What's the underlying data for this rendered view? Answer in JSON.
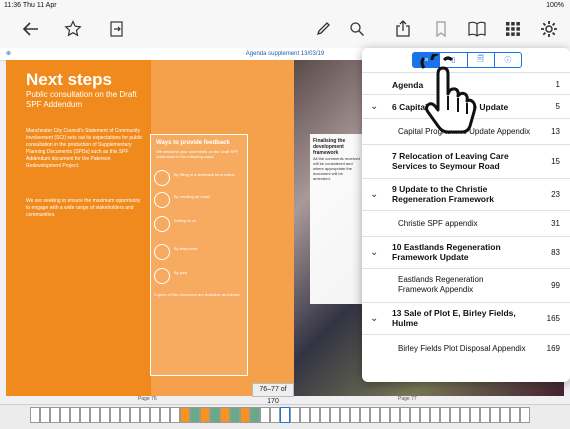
{
  "status": {
    "time": "11:36  Thu 11 Apr",
    "battery": "100%"
  },
  "toolbar": {
    "back": "arrow-left-icon",
    "star": "star-icon",
    "export": "export-icon",
    "pen": "pen-icon",
    "search": "search-icon",
    "share": "share-icon",
    "bookmark": "bookmark-icon",
    "book": "book-icon",
    "grid": "grid-icon",
    "settings": "gear-icon"
  },
  "doc": {
    "title": "Agenda supplement 13/03/19"
  },
  "page_content": {
    "heading": "Next steps",
    "subheading": "Public consultation on the Draft SPF Addendum",
    "para1": "Manchester City Council's Statement of Community Involvement (SCI) sets out its expectations for public consultation in the production of Supplementary Planning Documents (SPDs) such as this SPF Addendum document for the Paterson Redevelopment Project.",
    "para2": "We are seeking to ensure the maximum opportunity to engage with a wide range of stakeholders and communities.",
    "feedback_title": "Ways to provide feedback",
    "feedback_sub": "We welcome your comments on the Draft SPF Addendum in the following ways:",
    "feedback_items": [
      "By filling in a feedback form online",
      "By sending an email",
      "Writing to us",
      "By telephone",
      "By post"
    ],
    "copies_line": "Copies of this document are available as follows:",
    "right_title": "Finalising the development framework",
    "right_para": "All the comments received will be considered and where appropriate the document will be amended."
  },
  "page_left_label": "Page 76",
  "page_right_label": "Page 77",
  "page_indicator": "76–77 of 170",
  "panel": {
    "tabs": [
      "≡",
      "▯",
      "🗐",
      "ⓘ"
    ],
    "items": [
      {
        "label": "Agenda",
        "page": "1",
        "bold": true,
        "chevron": false
      },
      {
        "label": "6 Capital Programme Update",
        "page": "5",
        "bold": true,
        "chevron": true
      },
      {
        "label": "Capital Programme Update Appendix",
        "page": "13",
        "bold": false,
        "chevron": false
      },
      {
        "label": "7 Relocation of Leaving Care Services to Seymour Road",
        "page": "15",
        "bold": true,
        "chevron": false
      },
      {
        "label": "9 Update to the Christie Regeneration Framework",
        "page": "23",
        "bold": true,
        "chevron": true
      },
      {
        "label": "Christie SPF appendix",
        "page": "31",
        "bold": false,
        "chevron": false
      },
      {
        "label": "10 Eastlands Regeneration Framework Update",
        "page": "83",
        "bold": true,
        "chevron": true
      },
      {
        "label": "Eastlands Regeneration Framework Appendix",
        "page": "99",
        "bold": false,
        "chevron": false
      },
      {
        "label": "13 Sale of Plot E, Birley Fields, Hulme",
        "page": "165",
        "bold": true,
        "chevron": true
      },
      {
        "label": "Birley Fields Plot Disposal Appendix",
        "page": "169",
        "bold": false,
        "chevron": false
      }
    ]
  }
}
